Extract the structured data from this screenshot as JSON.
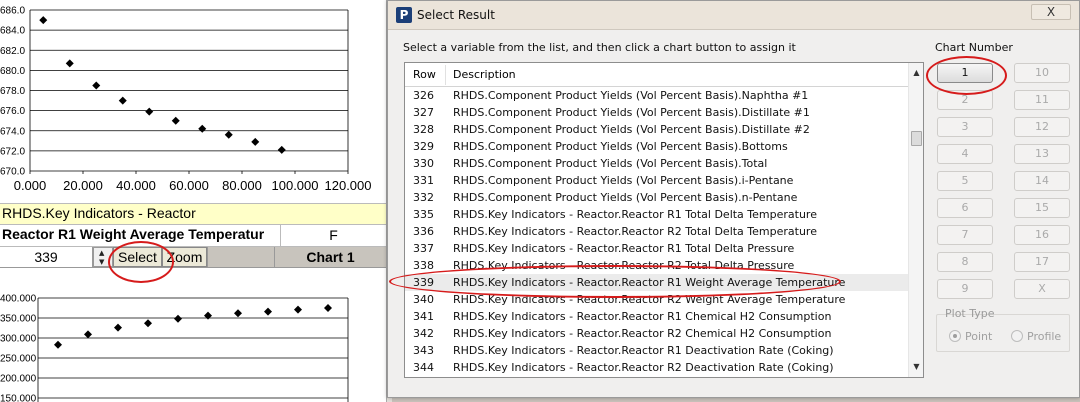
{
  "sheet": {
    "chart1": {
      "y_ticks": [
        "686.0",
        "684.0",
        "682.0",
        "680.0",
        "678.0",
        "676.0",
        "674.0",
        "672.0",
        "670.0"
      ],
      "x_ticks": [
        "0.000",
        "20.000",
        "40.000",
        "60.000",
        "80.000",
        "100.000",
        "120.000"
      ],
      "chart_data": {
        "type": "scatter",
        "x": [
          5,
          15,
          25,
          35,
          45,
          55,
          65,
          75,
          85,
          95
        ],
        "y": [
          685.0,
          680.7,
          678.5,
          677.0,
          675.9,
          675.0,
          674.2,
          673.6,
          672.9,
          672.1
        ],
        "xlim": [
          0,
          120
        ],
        "ylim": [
          670,
          686
        ]
      }
    },
    "title_row": "RHDS.Key Indicators - Reactor",
    "variable_name": "Reactor R1 Weight Average Temperatur",
    "unit": "F",
    "row_value": "339",
    "select_label": "Select",
    "zoom_label": "Zoom",
    "chart_label": "Chart 1",
    "chart2": {
      "y_ticks": [
        "400.000",
        "350.000",
        "300.000",
        "250.000",
        "200.000",
        "150.000"
      ],
      "chart_data": {
        "type": "scatter",
        "x": [
          5,
          15,
          25,
          35,
          45,
          55,
          65,
          75,
          85,
          95
        ],
        "y": [
          283,
          309,
          326,
          337,
          348,
          356,
          362,
          366,
          371,
          375
        ],
        "ylim": [
          150,
          400
        ]
      }
    }
  },
  "dialog": {
    "title": "Select Result",
    "app_icon_letter": "P",
    "close_label": "X",
    "instructions": "Select a variable from the list, and then click a chart button to assign it",
    "list": {
      "header_row": "Row",
      "header_desc": "Description",
      "rows": [
        {
          "row": "326",
          "desc": "RHDS.Component Product Yields (Vol Percent Basis).Naphtha #1"
        },
        {
          "row": "327",
          "desc": "RHDS.Component Product Yields (Vol Percent Basis).Distillate #1"
        },
        {
          "row": "328",
          "desc": "RHDS.Component Product Yields (Vol Percent Basis).Distillate #2"
        },
        {
          "row": "329",
          "desc": "RHDS.Component Product Yields (Vol Percent Basis).Bottoms"
        },
        {
          "row": "330",
          "desc": "RHDS.Component Product Yields (Vol Percent Basis).Total"
        },
        {
          "row": "331",
          "desc": "RHDS.Component Product Yields (Vol Percent Basis).i-Pentane"
        },
        {
          "row": "332",
          "desc": "RHDS.Component Product Yields (Vol Percent Basis).n-Pentane"
        },
        {
          "row": "335",
          "desc": "RHDS.Key Indicators - Reactor.Reactor R1 Total Delta Temperature"
        },
        {
          "row": "336",
          "desc": "RHDS.Key Indicators - Reactor.Reactor R2 Total Delta Temperature"
        },
        {
          "row": "337",
          "desc": "RHDS.Key Indicators - Reactor.Reactor R1 Total Delta Pressure"
        },
        {
          "row": "338",
          "desc": "RHDS.Key Indicators - Reactor.Reactor R2 Total Delta Pressure"
        },
        {
          "row": "339",
          "desc": "RHDS.Key Indicators - Reactor.Reactor R1 Weight Average Temperature"
        },
        {
          "row": "340",
          "desc": "RHDS.Key Indicators - Reactor.Reactor R2 Weight Average Temperature"
        },
        {
          "row": "341",
          "desc": "RHDS.Key Indicators - Reactor.Reactor R1 Chemical H2 Consumption"
        },
        {
          "row": "342",
          "desc": "RHDS.Key Indicators - Reactor.Reactor R2 Chemical H2 Consumption"
        },
        {
          "row": "343",
          "desc": "RHDS.Key Indicators - Reactor.Reactor R1 Deactivation Rate (Coking)"
        },
        {
          "row": "344",
          "desc": "RHDS.Key Indicators - Reactor.Reactor R2 Deactivation Rate (Coking)"
        }
      ]
    },
    "chart_number_label": "Chart Number",
    "chart_buttons": [
      "1",
      "2",
      "3",
      "4",
      "5",
      "6",
      "7",
      "8",
      "9",
      "10",
      "11",
      "12",
      "13",
      "14",
      "15",
      "16",
      "17",
      "X"
    ],
    "plot_type_label": "Plot Type",
    "plot_point": "Point",
    "plot_profile": "Profile",
    "accent_annotation_color": "#d61b1b"
  }
}
